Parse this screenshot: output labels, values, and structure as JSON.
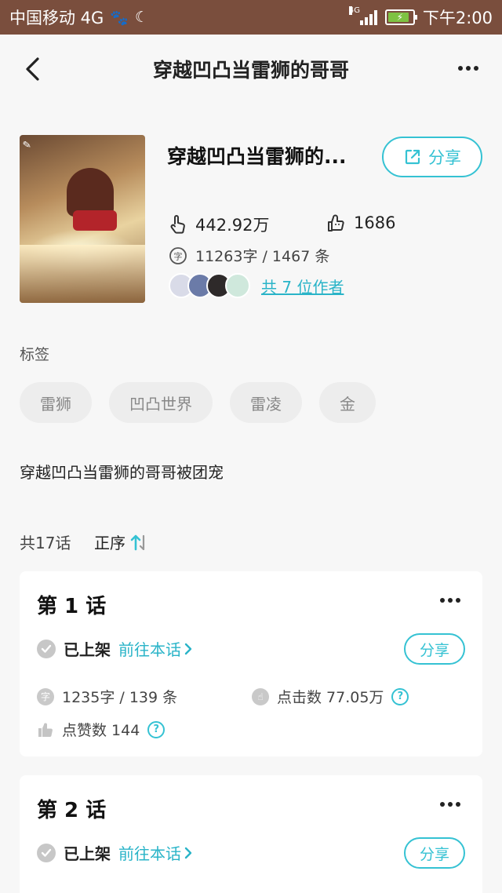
{
  "status_bar": {
    "carrier": "中国移动 4G",
    "network_tag": "4G",
    "time": "下午2:00",
    "icons": [
      "paw-icon",
      "moon-icon",
      "signal-icon",
      "battery-charging-icon"
    ]
  },
  "header": {
    "title": "穿越凹凸当雷狮的哥哥",
    "icons": [
      "back-arrow-icon",
      "more-icon"
    ]
  },
  "book": {
    "title": "穿越凹凸当雷狮的...",
    "share_label": "分享",
    "views": "442.92万",
    "likes": "1686",
    "words_count": "11263字 / 1467 条",
    "authors_link": "共 7 位作者",
    "avatar_colors": [
      "#d9dbe8",
      "#6b7ba8",
      "#2e2a2a",
      "#cfe8dc"
    ]
  },
  "tags": {
    "label": "标签",
    "items": [
      "雷狮",
      "凹凸世界",
      "雷凌",
      "金"
    ]
  },
  "description": "穿越凹凸当雷狮的哥哥被团宠",
  "episodes_header": {
    "count": "共17话",
    "order": "正序"
  },
  "episodes": [
    {
      "title": "第 1 话",
      "status": "已上架",
      "goto": "前往本话",
      "share": "分享",
      "words": "1235字 / 139 条",
      "clicks": "点击数 77.05万",
      "likes": "点赞数 144"
    },
    {
      "title": "第 2 话",
      "status": "已上架",
      "goto": "前往本话",
      "share": "分享"
    }
  ],
  "colors": {
    "accent": "#35c2d3",
    "status_bar": "#7a4e3d",
    "background": "#f7f7f7"
  }
}
